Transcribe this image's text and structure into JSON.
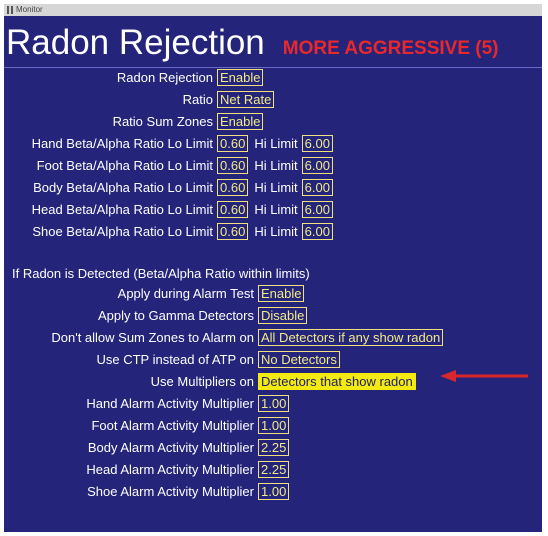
{
  "window": {
    "title": "Monitor"
  },
  "heading": {
    "title": "Radon Rejection",
    "mode": "MORE AGGRESSIVE (5)"
  },
  "settings": [
    {
      "label": "Radon Rejection",
      "value": "Enable"
    },
    {
      "label": "Ratio",
      "value": "Net Rate"
    },
    {
      "label": "Ratio Sum Zones",
      "value": "Enable"
    }
  ],
  "limits": {
    "hi_label": "Hi Limit",
    "rows": [
      {
        "label": "Hand Beta/Alpha Ratio Lo Limit",
        "lo": "0.60",
        "hi": "6.00"
      },
      {
        "label": "Foot Beta/Alpha Ratio Lo Limit",
        "lo": "0.60",
        "hi": "6.00"
      },
      {
        "label": "Body Beta/Alpha Ratio Lo Limit",
        "lo": "0.60",
        "hi": "6.00"
      },
      {
        "label": "Head Beta/Alpha Ratio Lo Limit",
        "lo": "0.60",
        "hi": "6.00"
      },
      {
        "label": "Shoe Beta/Alpha Ratio Lo Limit",
        "lo": "0.60",
        "hi": "6.00"
      }
    ]
  },
  "detected": {
    "heading": "If Radon is Detected (Beta/Alpha Ratio within limits)",
    "options": [
      {
        "label": "Apply during Alarm Test",
        "value": "Enable"
      },
      {
        "label": "Apply to Gamma Detectors",
        "value": "Disable"
      },
      {
        "label": "Don't allow Sum Zones to Alarm on",
        "value": "All Detectors if any show radon"
      },
      {
        "label": "Use CTP instead of ATP on",
        "value": "No Detectors"
      },
      {
        "label": "Use Multipliers on",
        "value": "Detectors that show radon"
      }
    ]
  },
  "multipliers": [
    {
      "label": "Hand Alarm Activity Multiplier",
      "value": "1.00"
    },
    {
      "label": "Foot Alarm Activity Multiplier",
      "value": "1.00"
    },
    {
      "label": "Body Alarm Activity Multiplier",
      "value": "2.25"
    },
    {
      "label": "Head Alarm Activity Multiplier",
      "value": "2.25"
    },
    {
      "label": "Shoe Alarm Activity Multiplier",
      "value": "1.00"
    }
  ],
  "colors": {
    "background": "#24247a",
    "value_text": "#f2ea88",
    "highlight": "#f3ea12",
    "mode_text": "#e8282b",
    "arrow": "#d9262a"
  }
}
